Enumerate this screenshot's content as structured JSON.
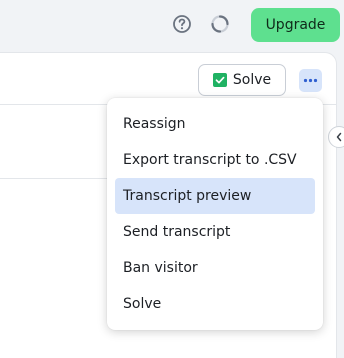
{
  "header": {
    "help_icon": "question-circle-icon",
    "loading_icon": "loading-spinner-icon",
    "upgrade_label": "Upgrade",
    "upgrade_color": "#5ee08f"
  },
  "toolbar": {
    "solve_label": "Solve",
    "solve_icon": "check-square-icon",
    "more_icon": "more-horizontal-icon",
    "accent_color": "#d7e4fa"
  },
  "menu": {
    "items": [
      {
        "label": "Reassign",
        "active": false
      },
      {
        "label": "Export transcript to .CSV",
        "active": false
      },
      {
        "label": "Transcript preview",
        "active": true
      },
      {
        "label": "Send transcript",
        "active": false
      },
      {
        "label": "Ban visitor",
        "active": false
      },
      {
        "label": "Solve",
        "active": false
      }
    ]
  },
  "sidebar": {
    "collapse_icon": "chevron-left-icon"
  }
}
